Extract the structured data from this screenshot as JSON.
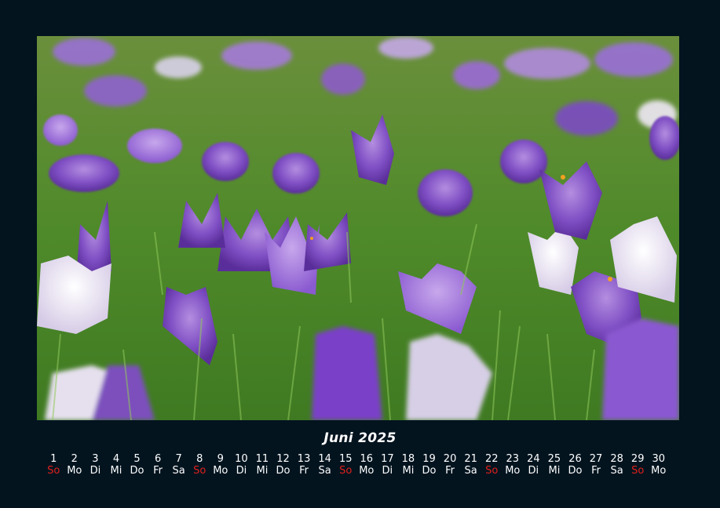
{
  "calendar": {
    "title": "Juni 2025",
    "days": [
      {
        "num": "1",
        "wd": "So",
        "sunday": true
      },
      {
        "num": "2",
        "wd": "Mo"
      },
      {
        "num": "3",
        "wd": "Di"
      },
      {
        "num": "4",
        "wd": "Mi"
      },
      {
        "num": "5",
        "wd": "Do"
      },
      {
        "num": "6",
        "wd": "Fr"
      },
      {
        "num": "7",
        "wd": "Sa"
      },
      {
        "num": "8",
        "wd": "So",
        "sunday": true
      },
      {
        "num": "9",
        "wd": "Mo"
      },
      {
        "num": "10",
        "wd": "Di"
      },
      {
        "num": "11",
        "wd": "Mi"
      },
      {
        "num": "12",
        "wd": "Do"
      },
      {
        "num": "13",
        "wd": "Fr"
      },
      {
        "num": "14",
        "wd": "Sa"
      },
      {
        "num": "15",
        "wd": "So",
        "sunday": true
      },
      {
        "num": "16",
        "wd": "Mo"
      },
      {
        "num": "17",
        "wd": "Di"
      },
      {
        "num": "18",
        "wd": "Mi"
      },
      {
        "num": "19",
        "wd": "Do"
      },
      {
        "num": "20",
        "wd": "Fr"
      },
      {
        "num": "21",
        "wd": "Sa"
      },
      {
        "num": "22",
        "wd": "So",
        "sunday": true
      },
      {
        "num": "23",
        "wd": "Mo"
      },
      {
        "num": "24",
        "wd": "Di"
      },
      {
        "num": "25",
        "wd": "Mi"
      },
      {
        "num": "26",
        "wd": "Do"
      },
      {
        "num": "27",
        "wd": "Fr"
      },
      {
        "num": "28",
        "wd": "Sa"
      },
      {
        "num": "29",
        "wd": "So",
        "sunday": true
      },
      {
        "num": "30",
        "wd": "Mo"
      }
    ]
  },
  "colors": {
    "background": "#03141f",
    "sunday": "#e0201c",
    "text": "#ffffff"
  }
}
